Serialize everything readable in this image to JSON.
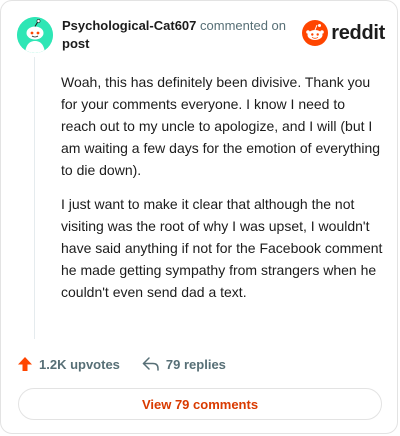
{
  "comment": {
    "username": "Psychological-Cat607",
    "action_text": "commented on",
    "target": "post",
    "paragraphs": [
      "Woah, this has definitely been divisive. Thank you for your comments everyone. I know I need to reach out to my uncle to apologize, and I will (but I am waiting a few days for the emotion of everything to die down).",
      "I just want to make it clear that although the not visiting was the root of why I was upset, I wouldn't have said anything if not for the Facebook comment he made getting sympathy from strangers when he couldn't even send dad a text."
    ]
  },
  "brand": {
    "wordmark": "reddit",
    "icon": "reddit-alien-icon",
    "color": "#ff4500"
  },
  "avatar": {
    "icon": "snoo-avatar-icon",
    "background": "#2ee6b5"
  },
  "actions": {
    "upvotes": "1.2K upvotes",
    "replies": "79 replies",
    "upvote_icon": "upvote-arrow-icon",
    "reply_icon": "reply-arrow-icon",
    "upvote_color": "#ff4500"
  },
  "view_button": {
    "label": "View 79 comments",
    "color": "#d93a00"
  }
}
